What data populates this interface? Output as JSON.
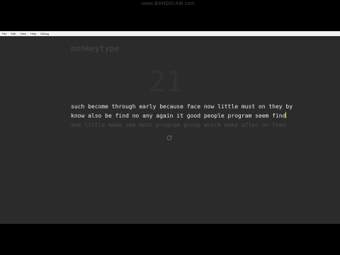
{
  "menu": {
    "items": [
      "File",
      "Edit",
      "View",
      "Help",
      "Debug"
    ]
  },
  "watermark": {
    "prefix": "www.",
    "brand": "BANDICAM",
    "suffix": ".com"
  },
  "app": {
    "logo": "monkeytype",
    "timer": "21",
    "words": {
      "line1": "such become through early because face now little must on they by",
      "line2_typed": "know also be find no any again it good people program seem find",
      "line3": "one little make see most program group which make after on then"
    }
  },
  "colors": {
    "background": "#2b2b2b",
    "typed": "#e8e8e8",
    "untyped": "#4c4c4c",
    "caret": "#e2b714"
  },
  "icons": {
    "restart": "restart-icon"
  }
}
